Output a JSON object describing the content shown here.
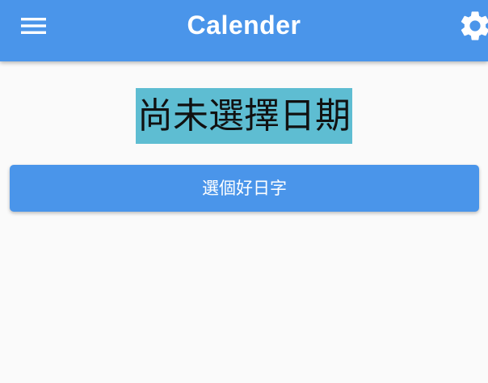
{
  "app_bar": {
    "title": "Calender",
    "background_color": "#4a95ea",
    "menu_icon": "hamburger-menu-icon",
    "settings_icon": "gear-icon"
  },
  "main": {
    "date_label": "尚未選擇日期",
    "date_label_background": "#5ebdd2",
    "pick_button_label": "選個好日字",
    "pick_button_color": "#4a95ea"
  }
}
